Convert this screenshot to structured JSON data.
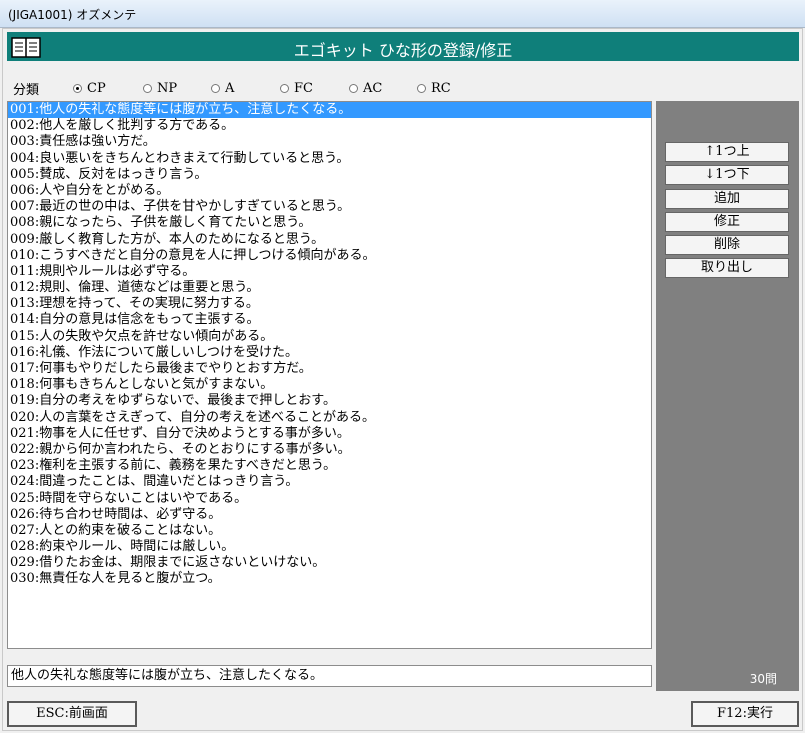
{
  "window": {
    "title": "(JIGA1001)  オズメンテ"
  },
  "header": {
    "title": "エゴキット  ひな形の登録/修正",
    "icon": "book-icon"
  },
  "category": {
    "label": "分類",
    "options": [
      "CP",
      "NP",
      "A",
      "FC",
      "AC",
      "RC"
    ],
    "selected": "CP"
  },
  "list": {
    "selected_index": 0,
    "items": [
      "001:他人の失礼な態度等には腹が立ち、注意したくなる。",
      "002:他人を厳しく批判する方である。",
      "003:責任感は強い方だ。",
      "004:良い悪いをきちんとわきまえて行動していると思う。",
      "005:賛成、反対をはっきり言う。",
      "006:人や自分をとがめる。",
      "007:最近の世の中は、子供を甘やかしすぎていると思う。",
      "008:親になったら、子供を厳しく育てたいと思う。",
      "009:厳しく教育した方が、本人のためになると思う。",
      "010:こうすべきだと自分の意見を人に押しつける傾向がある。",
      "011:規則やルールは必ず守る。",
      "012:規則、倫理、道徳などは重要と思う。",
      "013:理想を持って、その実現に努力する。",
      "014:自分の意見は信念をもって主張する。",
      "015:人の失敗や欠点を許せない傾向がある。",
      "016:礼儀、作法について厳しいしつけを受けた。",
      "017:何事もやりだしたら最後までやりとおす方だ。",
      "018:何事もきちんとしないと気がすまない。",
      "019:自分の考えをゆずらないで、最後まで押しとおす。",
      "020:人の言葉をさえぎって、自分の考えを述べることがある。",
      "021:物事を人に任せず、自分で決めようとする事が多い。",
      "022:親から何か言われたら、そのとおりにする事が多い。",
      "023:権利を主張する前に、義務を果たすべきだと思う。",
      "024:間違ったことは、間違いだとはっきり言う。",
      "025:時間を守らないことはいやである。",
      "026:待ち合わせ時間は、必ず守る。",
      "027:人との約束を破ることはない。",
      "028:約束やルール、時間には厳しい。",
      "029:借りたお金は、期限までに返さないといけない。",
      "030:無責任な人を見ると腹が立つ。"
    ]
  },
  "detail": {
    "text": "他人の失礼な態度等には腹が立ち、注意したくなる。"
  },
  "side_buttons": {
    "up": "↑1つ上",
    "down": "↓1つ下",
    "add": "追加",
    "edit": "修正",
    "delete": "削除",
    "retrieve": "取り出し"
  },
  "count": "30問",
  "footer": {
    "esc": "ESC:前画面",
    "f12": "F12:実行"
  },
  "colors": {
    "header_bg": "#0f7f7a",
    "selection": "#3399ff",
    "side_bg": "#808080"
  }
}
